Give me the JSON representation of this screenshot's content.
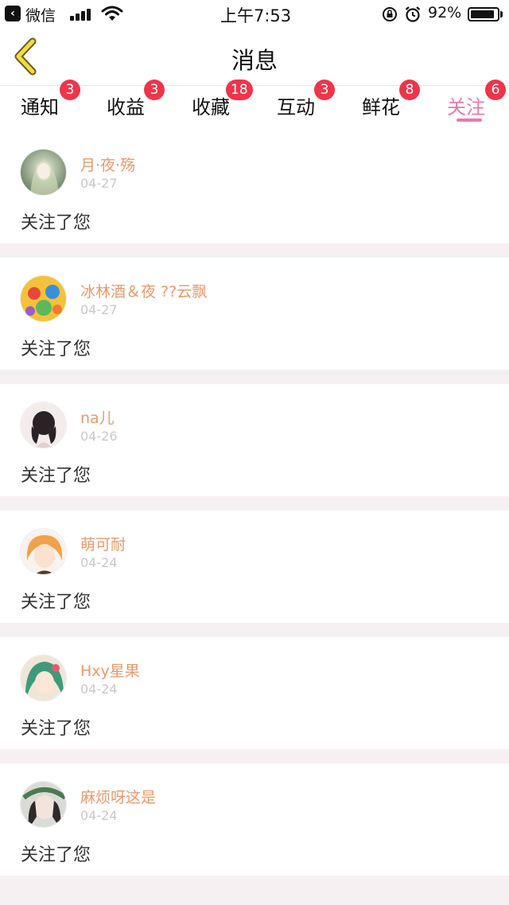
{
  "status_bar": {
    "back_icon": "back-arrow-icon",
    "carrier": "微信",
    "time": "上午7:53",
    "battery": "92%",
    "battery_level": 0.92
  },
  "header": {
    "title": "消息",
    "back_icon": "chevron-left-icon",
    "accent_color": "#e5d233"
  },
  "tabs": [
    {
      "label": "通知",
      "badge": "3",
      "active": false
    },
    {
      "label": "收益",
      "badge": "3",
      "active": false
    },
    {
      "label": "收藏",
      "badge": "18",
      "active": false
    },
    {
      "label": "互动",
      "badge": "3",
      "active": false
    },
    {
      "label": "鲜花",
      "badge": "8",
      "active": false
    },
    {
      "label": "关注",
      "badge": "6",
      "active": true
    }
  ],
  "colors": {
    "active_tab": "#e978ad",
    "badge": "#f0344a",
    "username": "#e89a6c",
    "date": "#c8c8c8"
  },
  "feed": [
    {
      "username": "月·夜·殇",
      "date": "04-27",
      "text": "关注了您",
      "avatar": "avatar-girl-green"
    },
    {
      "username": "冰林酒＆夜 ??云飘",
      "date": "04-27",
      "text": "关注了您",
      "avatar": "avatar-colorful-cartoon"
    },
    {
      "username": "na儿",
      "date": "04-26",
      "text": "关注了您",
      "avatar": "avatar-dark-hair"
    },
    {
      "username": "萌可耐",
      "date": "04-24",
      "text": "关注了您",
      "avatar": "avatar-anime-girl-orange"
    },
    {
      "username": "Hxy星果",
      "date": "04-24",
      "text": "关注了您",
      "avatar": "avatar-anime-girl-green"
    },
    {
      "username": "麻烦呀这是",
      "date": "04-24",
      "text": "关注了您",
      "avatar": "avatar-photo-girl"
    }
  ]
}
